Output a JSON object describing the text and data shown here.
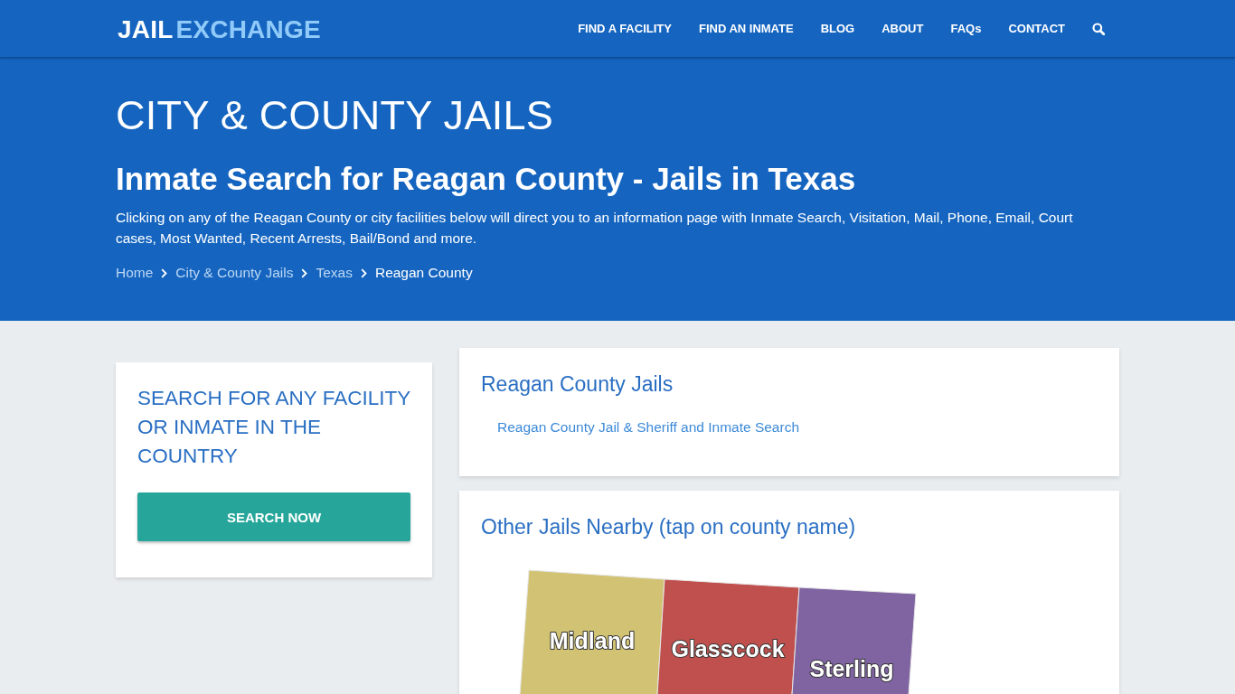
{
  "header": {
    "logo": {
      "primary": "JAIL",
      "accent": "EXCHANGE"
    },
    "nav": [
      "FIND A FACILITY",
      "FIND AN INMATE",
      "BLOG",
      "ABOUT",
      "FAQs",
      "CONTACT"
    ]
  },
  "hero": {
    "category": "CITY & COUNTY JAILS",
    "title": "Inmate Search for Reagan County - Jails in Texas",
    "description": "Clicking on any of the Reagan County or city facilities below will direct you to an information page with Inmate Search, Visitation, Mail, Phone, Email, Court cases, Most Wanted, Recent Arrests, Bail/Bond and more.",
    "breadcrumbs": [
      {
        "label": "Home",
        "current": false
      },
      {
        "label": "City & County Jails",
        "current": false
      },
      {
        "label": "Texas",
        "current": false
      },
      {
        "label": "Reagan County",
        "current": true
      }
    ]
  },
  "search_card": {
    "heading": "SEARCH FOR ANY FACILITY OR INMATE IN THE COUNTRY",
    "button": "SEARCH NOW"
  },
  "county_jails": {
    "heading": "Reagan County Jails",
    "links": [
      "Reagan County Jail & Sheriff and Inmate Search"
    ]
  },
  "nearby": {
    "heading": "Other Jails Nearby (tap on county name)",
    "counties": [
      {
        "name": "Midland",
        "color": "#d2c374"
      },
      {
        "name": "Glasscock",
        "color": "#c0504d"
      },
      {
        "name": "Sterling",
        "color": "#8064a2"
      }
    ]
  }
}
